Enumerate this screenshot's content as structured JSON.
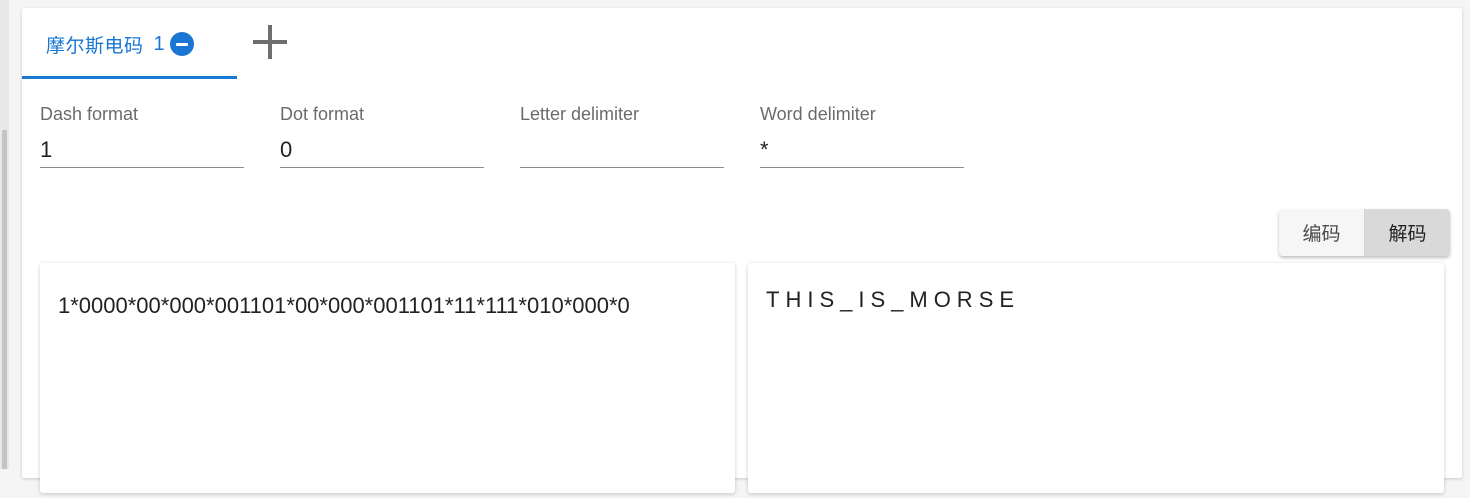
{
  "tabs": [
    {
      "label": "摩尔斯电码",
      "number": "1",
      "remove_icon": "minus-circle-icon"
    }
  ],
  "add_tab_icon": "plus-icon",
  "settings": {
    "dash_format": {
      "label": "Dash format",
      "value": "1"
    },
    "dot_format": {
      "label": "Dot format",
      "value": "0"
    },
    "letter_delimiter": {
      "label": "Letter delimiter",
      "value": ""
    },
    "word_delimiter": {
      "label": "Word delimiter",
      "value": "*"
    }
  },
  "mode": {
    "encode_label": "编码",
    "decode_label": "解码",
    "selected": "decode"
  },
  "input_text": "1*0000*00*000*001101*00*000*001101*11*111*010*000*0",
  "output_text": "THIS_IS_MORSE",
  "colors": {
    "accent": "#1976d2",
    "active_toggle": "#d9d9d9"
  }
}
